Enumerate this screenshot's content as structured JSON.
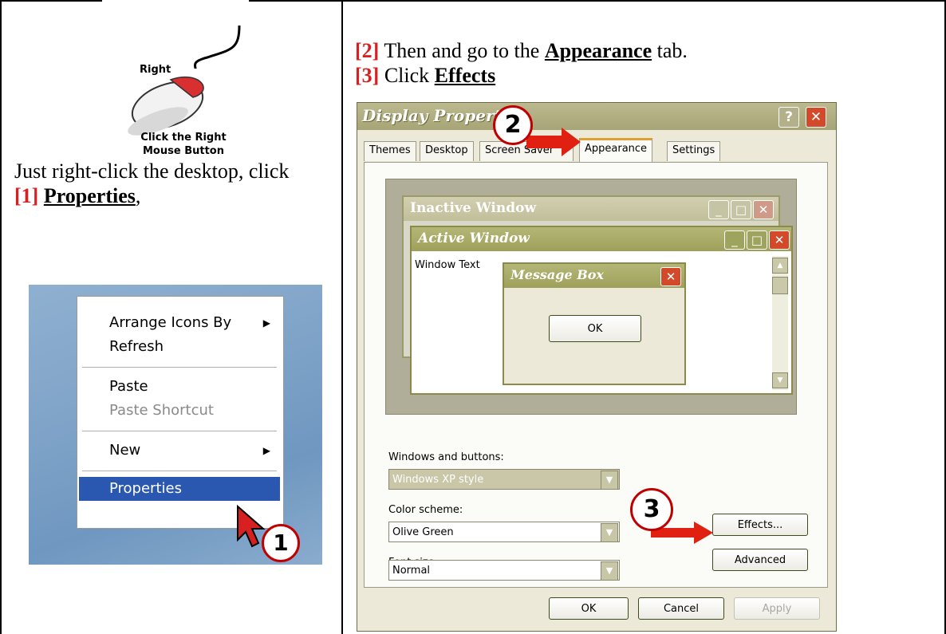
{
  "left": {
    "mouse_label": "Right",
    "mouse_caption_line1": "Click the Right",
    "mouse_caption_line2": "Mouse Button",
    "instr_part1": "Just right-click the desktop, click ",
    "instr_step": "[1]",
    "instr_link": "Properties",
    "instr_tail": ","
  },
  "context_menu": {
    "items": [
      {
        "label": "Arrange Icons By"
      },
      {
        "label": "Refresh"
      },
      {
        "label": "Paste"
      },
      {
        "label": "Paste Shortcut"
      },
      {
        "label": "New"
      },
      {
        "label": "Properties"
      }
    ],
    "submenu_arrow": "▶"
  },
  "callouts": {
    "one": "1",
    "two": "2",
    "three": "3"
  },
  "right": {
    "step2": "[2]",
    "step2_text": " Then and go to the ",
    "step2_link": "Appearance",
    "step2_tail": " tab.",
    "step3": "[3]",
    "step3_text": " Click ",
    "step3_link": "Effects"
  },
  "dialog": {
    "title": "Display Properties",
    "help_btn": "?",
    "close_btn": "✕",
    "tabs": [
      "Themes",
      "Desktop",
      "Screen Saver",
      "Appearance",
      "Settings"
    ],
    "active_tab": "Appearance",
    "preview": {
      "inactive_title": "Inactive Window",
      "active_title": "Active Window",
      "window_text": "Window Text",
      "msg_title": "Message Box",
      "msg_ok": "OK"
    },
    "windows_buttons_label": "Windows and buttons:",
    "windows_buttons_value": "Windows XP style",
    "color_scheme_label": "Color scheme:",
    "color_scheme_value": "Olive Green",
    "font_size_label": "Font size:",
    "font_size_value": "Normal",
    "effects_btn": "Effects...",
    "advanced_btn": "Advanced",
    "ok_btn": "OK",
    "cancel_btn": "Cancel",
    "apply_btn": "Apply"
  },
  "colors": {
    "accent_red": "#d82020",
    "menu_highlight": "#2a58b0",
    "olive_title": "#a7a476"
  }
}
